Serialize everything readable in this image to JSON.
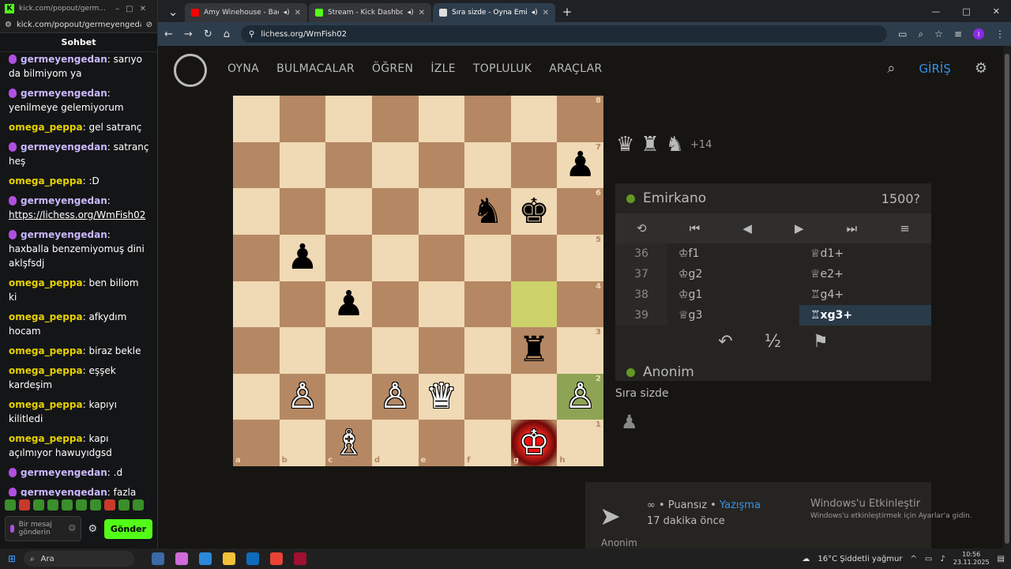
{
  "popup": {
    "title": "kick.com/popout/germ...",
    "url": "kick.com/popout/germeyengeda...",
    "header": "Sohbet"
  },
  "chat": [
    {
      "u": "germeyengedan",
      "t": "sarıyo da bilmiyom ya",
      "mic": true
    },
    {
      "u": "germeyengedan",
      "t": "yenilmeye gelemiyorum",
      "mic": true
    },
    {
      "u": "omega_peppa",
      "t": "gel satranç",
      "mic": false
    },
    {
      "u": "germeyengedan",
      "t": "satranç heş",
      "mic": true
    },
    {
      "u": "omega_peppa",
      "t": ":D",
      "mic": false
    },
    {
      "u": "germeyengedan",
      "t": "https://lichess.org/WmFish02",
      "mic": true,
      "link": true
    },
    {
      "u": "germeyengedan",
      "t": "haxballa benzemiyomuş dini aklşfsdj",
      "mic": true
    },
    {
      "u": "omega_peppa",
      "t": "ben biliom ki",
      "mic": false
    },
    {
      "u": "omega_peppa",
      "t": "afkydım hocam",
      "mic": false
    },
    {
      "u": "omega_peppa",
      "t": "biraz bekle",
      "mic": false
    },
    {
      "u": "omega_peppa",
      "t": "eşşek kardeşim",
      "mic": false
    },
    {
      "u": "omega_peppa",
      "t": "kapıyı kilitledi",
      "mic": false
    },
    {
      "u": "omega_peppa",
      "t": "kapı açılmıyor hawuyıdgsd",
      "mic": false
    },
    {
      "u": "germeyengedan",
      "t": ".d",
      "mic": true
    },
    {
      "u": "germeyengedan",
      "t": "fazla hafife aldım afjşlfa",
      "mic": true
    }
  ],
  "chat_input": {
    "placeholder": "Bir mesaj gönderin",
    "send": "Gönder"
  },
  "tabs": [
    {
      "title": "Amy Winehouse - Back To",
      "color": "#ff0000"
    },
    {
      "title": "Stream - Kick Dashboard",
      "color": "#53fc18"
    },
    {
      "title": "Sıra sizde - Oyna Emirkano",
      "color": "#dddddd"
    }
  ],
  "address": "lichess.org/WmFish02",
  "nav": {
    "links": [
      "OYNA",
      "BULMACALAR",
      "ÖĞREN",
      "İZLE",
      "TOPLULUK",
      "ARAÇLAR"
    ],
    "login": "GİRİŞ"
  },
  "board": {
    "files": [
      "a",
      "b",
      "c",
      "d",
      "e",
      "f",
      "g",
      "h"
    ],
    "ranks": [
      "8",
      "7",
      "6",
      "5",
      "4",
      "3",
      "2",
      "1"
    ],
    "pieces": {
      "h7": "♟b",
      "f6": "♞b",
      "g6": "♚b",
      "b5": "♟b",
      "c4": "♟b",
      "g3": "♜b",
      "b2": "♙w",
      "d2": "♙w",
      "e2": "♛w",
      "h2": "♙w",
      "c1": "♗w",
      "g1": "♔w"
    },
    "highlights": {
      "g4": "hl",
      "h2": "hld",
      "g1": "chk"
    }
  },
  "material": {
    "icons": [
      "♛",
      "♜",
      "♞"
    ],
    "advantage": "+14"
  },
  "players": {
    "top": {
      "name": "Emirkano",
      "rating": "1500?"
    },
    "bottom": {
      "name": "Anonim"
    }
  },
  "moves": [
    {
      "n": "36",
      "w": "♔f1",
      "b": "♕d1+"
    },
    {
      "n": "37",
      "w": "♔g2",
      "b": "♕e2+"
    },
    {
      "n": "38",
      "w": "♔g1",
      "b": "♖g4+"
    },
    {
      "n": "39",
      "w": "♕g3",
      "b": "♖xg3+"
    }
  ],
  "turn": "Sıra sizde",
  "game_card": {
    "line1": "∞ • Puansız •",
    "link": "Yazışma",
    "line2": "17 dakika önce",
    "player": "Anonim"
  },
  "watermark": {
    "a": "Windows'u Etkinleştir",
    "b": "Windows'u etkinleştirmek için Ayarlar'a gidin."
  },
  "taskbar": {
    "search": "Ara",
    "weather": "16°C  Şiddetli yağmur",
    "time": "10:56",
    "date": "23.11.2025"
  }
}
